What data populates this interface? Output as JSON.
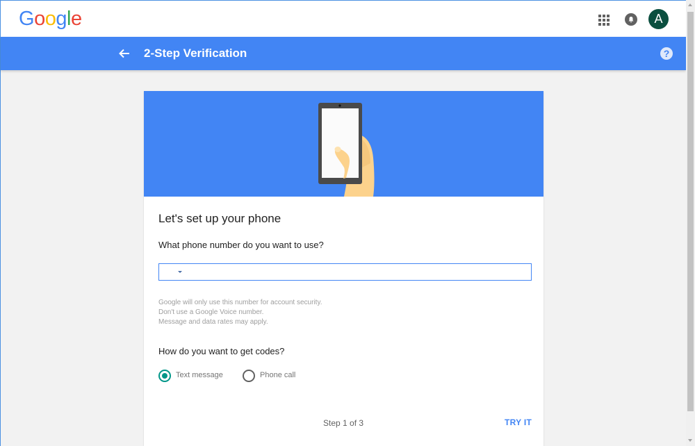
{
  "header": {
    "logo_text": "Google",
    "logo_colors": [
      "#4285f4",
      "#ea4335",
      "#fbbc05",
      "#4285f4",
      "#34a853",
      "#ea4335"
    ],
    "avatar_initial": "A",
    "avatar_color": "#0b4f3f"
  },
  "bar": {
    "title": "2-Step Verification",
    "help_symbol": "?",
    "color": "#4285f4"
  },
  "card": {
    "heading": "Let's set up your phone",
    "phone_question": "What phone number do you want to use?",
    "phone_value": "",
    "hint_lines": [
      "Google will only use this number for account security.",
      "Don't use a Google Voice number.",
      "Message and data rates may apply."
    ],
    "codes_question": "How do you want to get codes?",
    "options": [
      {
        "label": "Text message",
        "selected": true
      },
      {
        "label": "Phone call",
        "selected": false
      }
    ],
    "step_text": "Step 1 of 3",
    "try_label": "TRY IT"
  },
  "icons": [
    "back-arrow-icon",
    "apps-grid-icon",
    "notification-bell-icon",
    "help-icon",
    "dropdown-caret-icon",
    "phone-in-hand-illustration"
  ],
  "accent_colors": {
    "radio_selected": "#009688"
  }
}
